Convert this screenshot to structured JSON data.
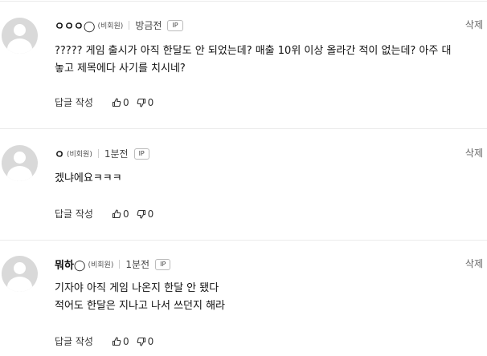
{
  "comments": [
    {
      "nickname": "ㅇㅇㅇ◯",
      "member_type": "(비회원)",
      "time": "방금전",
      "ip_badge": "IP",
      "delete_label": "삭제",
      "text_lines": [
        "????? 게임 출시가 아직 한달도 안 되었는데? 매출 10위 이상 올라간 적이 없는데? 아주 대",
        "놓고 제목에다 사기를 치시네?"
      ],
      "reply_label": "답글 작성",
      "likes": "0",
      "dislikes": "0"
    },
    {
      "nickname": "ㅇ",
      "member_type": "(비회원)",
      "time": "1분전",
      "ip_badge": "IP",
      "delete_label": "삭제",
      "text_lines": [
        "겠냐에요ㅋㅋㅋ"
      ],
      "reply_label": "답글 작성",
      "likes": "0",
      "dislikes": "0"
    },
    {
      "nickname": "뭐하◯",
      "member_type": "(비회원)",
      "time": "1분전",
      "ip_badge": "IP",
      "delete_label": "삭제",
      "text_lines": [
        "기자야 아직 게임 나온지 한달 안 됐다",
        "적어도 한달은 지나고 나서 쓰던지 해라"
      ],
      "reply_label": "답글 작성",
      "likes": "0",
      "dislikes": "0"
    }
  ]
}
